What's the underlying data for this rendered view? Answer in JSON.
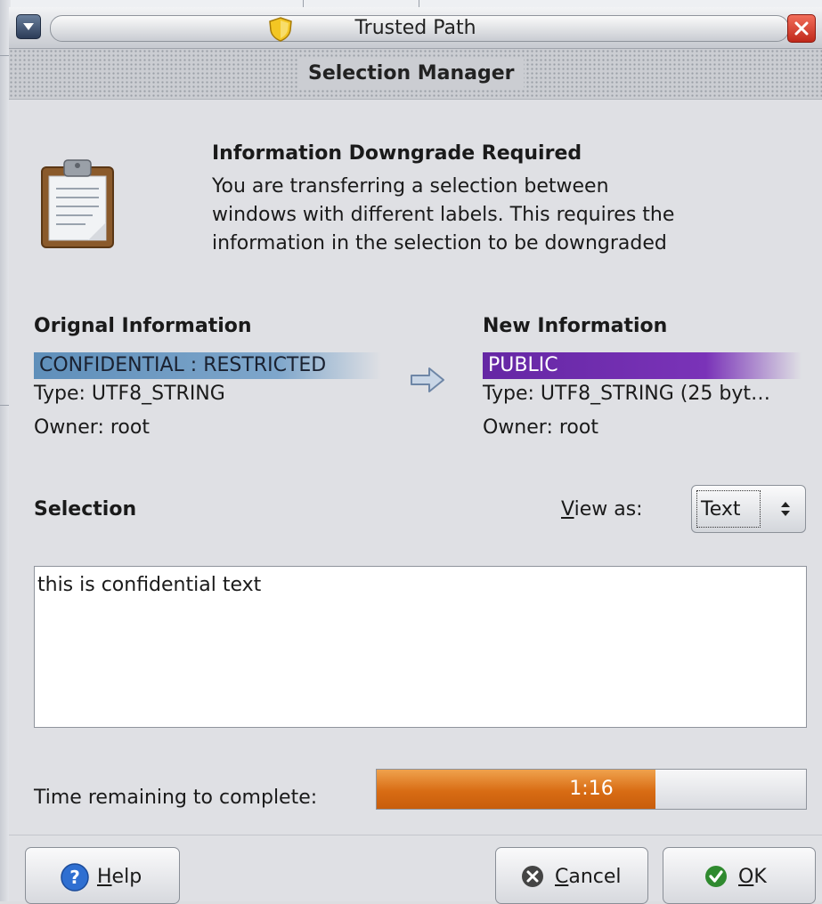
{
  "window": {
    "title": "Trusted Path",
    "header": "Selection Manager"
  },
  "info": {
    "title": "Information Downgrade Required",
    "lines": [
      "You are transferring a selection between",
      "windows with different labels.  This requires the",
      "information in the selection to be downgraded"
    ]
  },
  "original": {
    "heading": "Orignal Information",
    "label": "CONFIDENTIAL : RESTRICTED",
    "type": "Type: UTF8_STRING",
    "owner": "Owner: root"
  },
  "new": {
    "heading": "New Information",
    "label": "PUBLIC",
    "type": "Type: UTF8_STRING (25 byt…",
    "owner": "Owner: root"
  },
  "selection": {
    "heading": "Selection",
    "view_as_label_mnemonic": "V",
    "view_as_label_rest": "iew as:",
    "view_as_value": "Text",
    "text": "this is confidential text"
  },
  "timer": {
    "label": "Time remaining to complete:",
    "value": "1:16",
    "progress_percent": 65
  },
  "buttons": {
    "help_mnemonic": "H",
    "help_rest": "elp",
    "cancel_mnemonic": "C",
    "cancel_rest": "ancel",
    "ok_mnemonic": "O",
    "ok_rest": "K"
  },
  "colors": {
    "original_label": "#5f8fba",
    "new_label": "#6527a4",
    "progress": "#d86c14"
  },
  "icons": [
    "window-menu-icon",
    "shield-icon",
    "close-icon",
    "clipboard-icon",
    "arrow-right-icon",
    "help-icon",
    "cancel-icon",
    "ok-icon",
    "spinner-arrows-icon"
  ]
}
